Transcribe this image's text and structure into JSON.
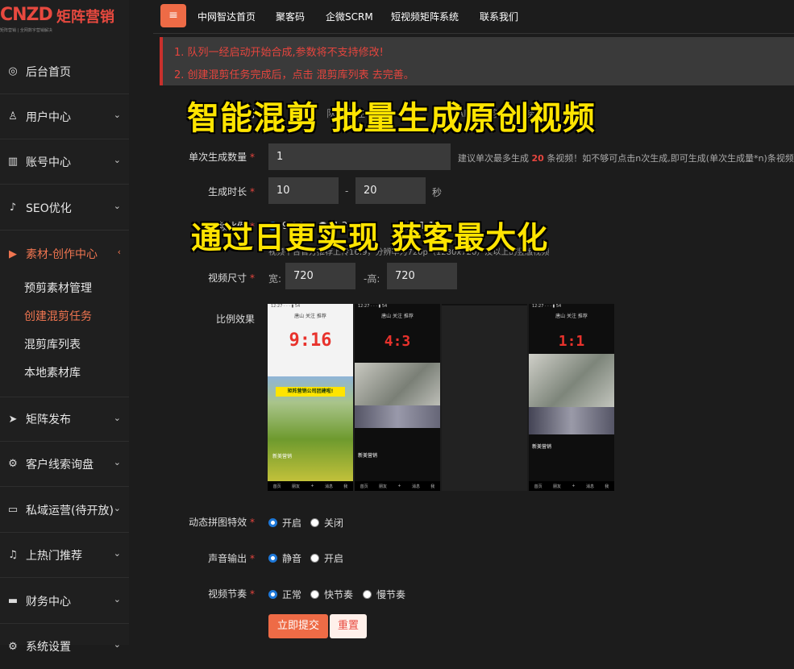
{
  "brand": {
    "logo_text": "CNZD",
    "name": "矩阵营销",
    "tagline": "矩阵营销 | 全网数字营销解决"
  },
  "sidebar": {
    "items": [
      {
        "label": "后台首页",
        "icon": "dashboard-icon"
      },
      {
        "label": "用户中心",
        "icon": "user-icon"
      },
      {
        "label": "账号中心",
        "icon": "chart-icon"
      },
      {
        "label": "SEO优化",
        "icon": "tiktok-icon"
      },
      {
        "label": "素材-创作中心",
        "icon": "video-icon"
      },
      {
        "label": "矩阵发布",
        "icon": "send-icon"
      },
      {
        "label": "客户线索询盘",
        "icon": "gear-icon"
      },
      {
        "label": "私域运营(待开放)",
        "icon": "folder-icon"
      },
      {
        "label": "上热门推荐",
        "icon": "bell-icon"
      },
      {
        "label": "财务中心",
        "icon": "card-icon"
      },
      {
        "label": "系统设置",
        "icon": "settings-icon"
      }
    ],
    "subitems": [
      "预剪素材管理",
      "创建混剪任务",
      "混剪库列表",
      "本地素材库"
    ]
  },
  "topnav": [
    "中网智达首页",
    "聚客码",
    "企微SCRM",
    "短视频矩阵系统",
    "联系我们"
  ],
  "notice": [
    "1. 队列一经启动开始合成,参数将不支持修改!",
    "2. 创建混剪任务完成后，点击 混剪库列表 去完善。"
  ],
  "overlay": {
    "line1": "智能混剪 批量生成原创视频",
    "line2": "通过日更实现 获客最大化"
  },
  "form": {
    "queue_label": "队列",
    "queue_placeholder": "队列备注",
    "queue_extra": "APP 混剪视频任务",
    "count_label": "单次生成数量",
    "count_value": "1",
    "count_hint_pre": "建议单次最多生成",
    "count_hint_num": "20",
    "count_hint_post": "条视频！如不够可点击n次生成,即可生成(单次生成量*n)条视频!",
    "duration_label": "生成时长",
    "duration_min": "10",
    "duration_sep": "-",
    "duration_max": "20",
    "duration_unit": "秒",
    "ratio_label": "视频比例",
    "ratio_options": [
      "9:16",
      "4:3",
      "1:1"
    ],
    "ratio_hint": "视频平台官方推荐上传16:9，分辨率为720p（1280x720）及以上的竖版视频",
    "size_label": "视频尺寸",
    "width_label": "宽:",
    "width_value": "720",
    "height_label": "-高:",
    "height_value": "720",
    "preview_label": "比例效果",
    "collage_label": "动态拼图特效",
    "collage_on": "开启",
    "collage_off": "关闭",
    "audio_label": "声音输出",
    "audio_mute": "静音",
    "audio_on": "开启",
    "rhythm_label": "视频节奏",
    "rhythm_normal": "正常",
    "rhythm_fast": "快节奏",
    "rhythm_slow": "慢节奏",
    "submit": "立即提交",
    "reset": "重置"
  },
  "phones": [
    {
      "ratio": "9:16",
      "tabs": "唐山 关注 推荐",
      "banner": "矩阵营销公司团建啦!",
      "caption": "新美营销"
    },
    {
      "ratio": "4:3",
      "tabs": "唐山 关注 推荐",
      "caption": "新美营销"
    },
    {
      "ratio": "1:1",
      "tabs": "唐山 关注 推荐",
      "caption": "新美营销"
    }
  ],
  "phone_bottom": [
    "首页",
    "朋友",
    "+",
    "消息",
    "我"
  ],
  "colors": {
    "accent": "#ee6b46",
    "danger": "#e5453e",
    "highlight": "#ffe400"
  }
}
